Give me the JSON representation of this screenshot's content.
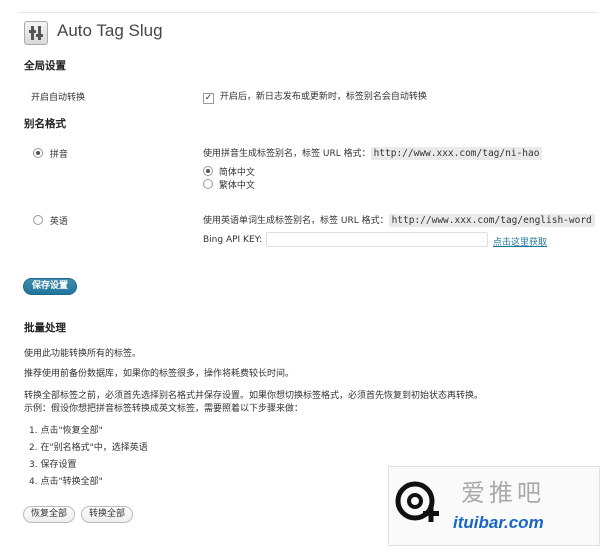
{
  "header": {
    "title": "Auto Tag Slug"
  },
  "global": {
    "heading": "全局设置",
    "auto_label": "开启自动转换",
    "auto_check_mark": "✓",
    "auto_desc": "开启后，新日志发布或更新时，标签别名会自动转换"
  },
  "alias": {
    "heading": "别名格式",
    "pinyin": {
      "label": "拼音",
      "desc": "使用拼音生成标签别名，标签 URL 格式：",
      "url": "http://www.xxx.com/tag/ni-hao",
      "opt_simplified": "简体中文",
      "opt_traditional": "繁体中文"
    },
    "english": {
      "label": "英语",
      "desc": "使用英语单词生成标签别名，标签 URL 格式：",
      "url": "http://www.xxx.com/tag/english-word",
      "api_label": "Bing API KEY:",
      "api_value": "",
      "api_link": "点击这里获取"
    }
  },
  "save_button": "保存设置",
  "batch": {
    "heading": "批量处理",
    "p1": "使用此功能转换所有的标签。",
    "p2": "推荐使用前备份数据库，如果你的标签很多，操作将耗费较长时间。",
    "p3_line1": "转换全部标签之前，必须首先选择别名格式并保存设置。如果你想切换标签格式，必须首先恢复到初始状态再转换。",
    "p3_line2": "示例：假设你想把拼音标签转换成英文标签，需要照着以下步骤来做：",
    "steps": [
      "1.  点击\"恢复全部\"",
      "2.  在\"别名格式\"中，选择英语",
      "3.  保存设置",
      "4.  点击\"转换全部\""
    ],
    "restore_button": "恢复全部",
    "convert_button": "转换全部"
  },
  "watermark": {
    "cn_text": "爱推吧",
    "domain": "ituibar.com",
    "domain_color": "#1a66c8"
  }
}
